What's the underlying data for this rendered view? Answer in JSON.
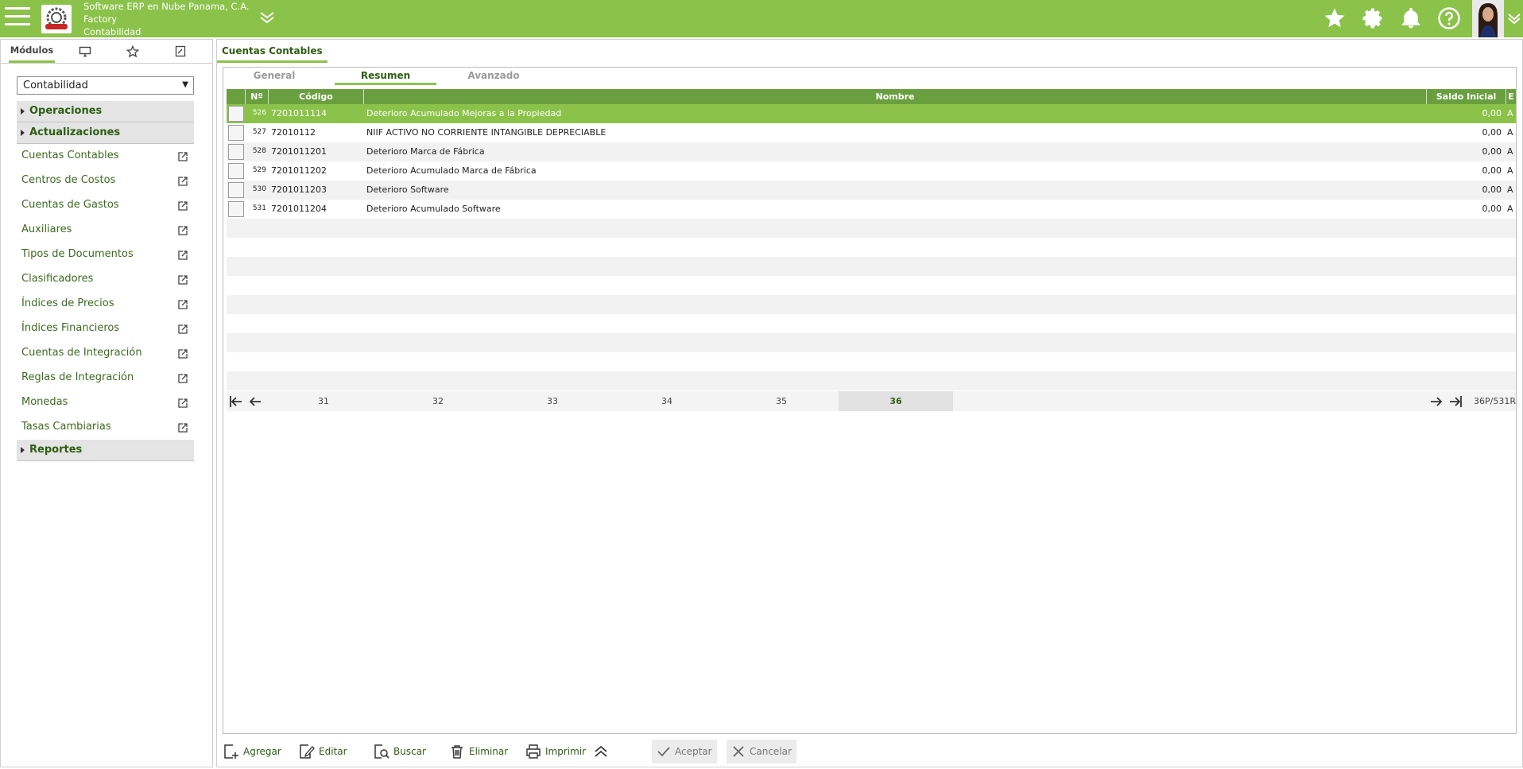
{
  "header": {
    "company": "Software ERP en Nube Panama, C.A.",
    "branch": "Factory",
    "module": "Contabilidad"
  },
  "left_tabs": [
    "Módulos"
  ],
  "module_select": "Contabilidad",
  "sections": {
    "operaciones": "Operaciones",
    "actualizaciones": "Actualizaciones",
    "reportes": "Reportes"
  },
  "menu_items": [
    "Cuentas Contables",
    "Centros de Costos",
    "Cuentas de Gastos",
    "Auxiliares",
    "Tipos de Documentos",
    "Clasificadores",
    "Índices de Precios",
    "Índices Financieros",
    "Cuentas de Integración",
    "Reglas de Integración",
    "Monedas",
    "Tasas Cambiarias"
  ],
  "main_tab": "Cuentas Contables",
  "inner_tabs": [
    "General",
    "Resumen",
    "Avanzado"
  ],
  "grid": {
    "headers": {
      "n": "Nº",
      "codigo": "Código",
      "nombre": "Nombre",
      "saldo": "Saldo Inicial",
      "e": "E"
    },
    "rows": [
      {
        "n": "526",
        "codigo": "7201011114",
        "nombre": "Deterioro Acumulado Mejoras a la Propiedad",
        "saldo": "0,00",
        "e": "A"
      },
      {
        "n": "527",
        "codigo": "72010112",
        "nombre": "NIIF ACTIVO NO CORRIENTE INTANGIBLE DEPRECIABLE",
        "saldo": "0,00",
        "e": "A"
      },
      {
        "n": "528",
        "codigo": "7201011201",
        "nombre": "Deterioro Marca de Fábrica",
        "saldo": "0,00",
        "e": "A"
      },
      {
        "n": "529",
        "codigo": "7201011202",
        "nombre": "Deterioro Acumulado Marca de Fábrica",
        "saldo": "0,00",
        "e": "A"
      },
      {
        "n": "530",
        "codigo": "7201011203",
        "nombre": "Deterioro Software",
        "saldo": "0,00",
        "e": "A"
      },
      {
        "n": "531",
        "codigo": "7201011204",
        "nombre": "Deterioro Acumulado Software",
        "saldo": "0,00",
        "e": "A"
      }
    ]
  },
  "pager": {
    "pages": [
      "31",
      "32",
      "33",
      "34",
      "35",
      "36"
    ],
    "info": "36P/531R"
  },
  "toolbar": {
    "agregar": "Agregar",
    "editar": "Editar",
    "buscar": "Buscar",
    "eliminar": "Eliminar",
    "imprimir": "Imprimir",
    "aceptar": "Aceptar",
    "cancelar": "Cancelar"
  },
  "colors": {
    "brand": "#8bc34a",
    "header_dark": "#6a9f3f",
    "text_green": "#2d5e12"
  }
}
